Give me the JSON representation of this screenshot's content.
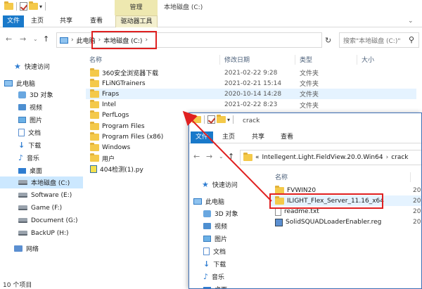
{
  "colors": {
    "accent": "#1979ca",
    "annotation": "#e02020",
    "selected": "#cce8ff"
  },
  "window1": {
    "title": "本地磁盘 (C:)",
    "manage_tab": "管理",
    "ribbon": {
      "file": "文件",
      "home": "主页",
      "share": "共享",
      "view": "查看",
      "drive_tools": "驱动器工具"
    },
    "address": {
      "root": "此电脑",
      "drive": "本地磁盘 (C:)"
    },
    "search_placeholder": "搜索\"本地磁盘 (C:)\"",
    "columns": {
      "name": "名称",
      "date": "修改日期",
      "type": "类型",
      "size": "大小"
    },
    "nav": [
      {
        "label": "快速访问",
        "icon": "star-icon"
      },
      {
        "label": "此电脑",
        "icon": "pc-icon"
      },
      {
        "label": "3D 对象",
        "icon": "3d-objects-icon"
      },
      {
        "label": "视频",
        "icon": "video-icon"
      },
      {
        "label": "图片",
        "icon": "pictures-icon"
      },
      {
        "label": "文档",
        "icon": "documents-icon"
      },
      {
        "label": "下载",
        "icon": "download-icon"
      },
      {
        "label": "音乐",
        "icon": "music-icon"
      },
      {
        "label": "桌面",
        "icon": "desktop-icon"
      },
      {
        "label": "本地磁盘 (C:)",
        "icon": "drive-icon"
      },
      {
        "label": "Software (E:)",
        "icon": "drive-icon"
      },
      {
        "label": "Game (F:)",
        "icon": "drive-icon"
      },
      {
        "label": "Document (G:)",
        "icon": "drive-icon"
      },
      {
        "label": "BackUP (H:)",
        "icon": "drive-icon"
      },
      {
        "label": "网络",
        "icon": "network-icon"
      }
    ],
    "files": [
      {
        "name": "360安全浏览器下载",
        "date": "2021-02-22 9:28",
        "type": "文件夹",
        "icon": "folder-icon"
      },
      {
        "name": "FLiNGTrainers",
        "date": "2021-02-21 15:14",
        "type": "文件夹",
        "icon": "folder-icon"
      },
      {
        "name": "Fraps",
        "date": "2020-10-14 14:28",
        "type": "文件夹",
        "icon": "folder-icon"
      },
      {
        "name": "Intel",
        "date": "2021-02-22 8:23",
        "type": "文件夹",
        "icon": "folder-icon"
      },
      {
        "name": "PerfLogs",
        "date": "",
        "type": "",
        "icon": "folder-icon"
      },
      {
        "name": "Program Files",
        "date": "",
        "type": "",
        "icon": "folder-icon"
      },
      {
        "name": "Program Files (x86)",
        "date": "",
        "type": "",
        "icon": "folder-icon"
      },
      {
        "name": "Windows",
        "date": "",
        "type": "",
        "icon": "folder-icon"
      },
      {
        "name": "用户",
        "date": "",
        "type": "",
        "icon": "folder-icon"
      },
      {
        "name": "404检测(1).py",
        "date": "",
        "type": "",
        "icon": "python-file-icon"
      }
    ],
    "status": "10 个项目"
  },
  "window2": {
    "title": "crack",
    "ribbon": {
      "file": "文件",
      "home": "主页",
      "share": "共享",
      "view": "查看"
    },
    "address": {
      "overflow": "«",
      "part1": "Intellegent.Light.FieldView.20.0.Win64",
      "part2": "crack"
    },
    "columns": {
      "name": "名称"
    },
    "nav": [
      {
        "label": "快速访问",
        "icon": "star-icon"
      },
      {
        "label": "此电脑",
        "icon": "pc-icon"
      },
      {
        "label": "3D 对象",
        "icon": "3d-objects-icon"
      },
      {
        "label": "视频",
        "icon": "video-icon"
      },
      {
        "label": "图片",
        "icon": "pictures-icon"
      },
      {
        "label": "文档",
        "icon": "documents-icon"
      },
      {
        "label": "下载",
        "icon": "download-icon"
      },
      {
        "label": "音乐",
        "icon": "music-icon"
      },
      {
        "label": "桌面",
        "icon": "desktop-icon"
      }
    ],
    "files": [
      {
        "name": "FVWIN20",
        "date": "20",
        "icon": "folder-icon"
      },
      {
        "name": "ILIGHT_Flex_Server_11.16_x64",
        "date": "20",
        "icon": "folder-icon"
      },
      {
        "name": "readme.txt",
        "date": "20",
        "icon": "text-file-icon"
      },
      {
        "name": "SolidSQUADLoaderEnabler.reg",
        "date": "20",
        "icon": "registry-file-icon"
      }
    ]
  }
}
